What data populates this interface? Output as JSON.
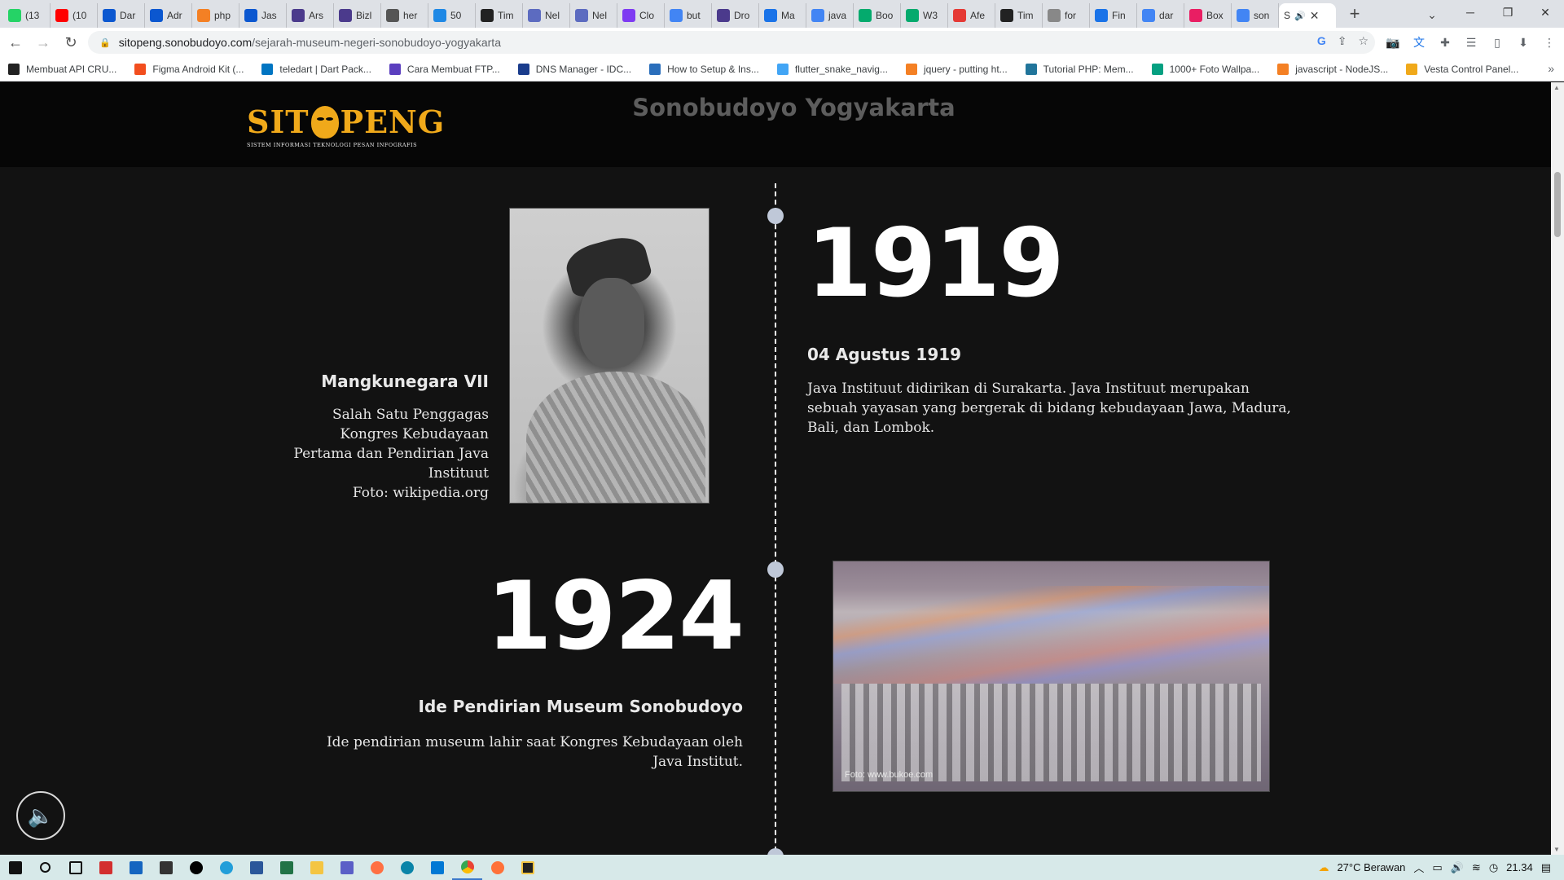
{
  "browser": {
    "tabs": [
      {
        "label": "(13",
        "color": "#25d366"
      },
      {
        "label": "(10",
        "color": "#ff0000"
      },
      {
        "label": "Dar",
        "color": "#0b57d0"
      },
      {
        "label": "Adr",
        "color": "#0b57d0"
      },
      {
        "label": "php",
        "color": "#f48024"
      },
      {
        "label": "Jas",
        "color": "#0b57d0"
      },
      {
        "label": "Ars",
        "color": "#4b3a8c"
      },
      {
        "label": "Bizl",
        "color": "#4b3a8c"
      },
      {
        "label": "her",
        "color": "#555555"
      },
      {
        "label": "50",
        "color": "#1e88e5"
      },
      {
        "label": "Tim",
        "color": "#222222"
      },
      {
        "label": "Nel",
        "color": "#5c6bc0"
      },
      {
        "label": "Nel",
        "color": "#5c6bc0"
      },
      {
        "label": "Clo",
        "color": "#7e3af2"
      },
      {
        "label": "but",
        "color": "#4285f4"
      },
      {
        "label": "Dro",
        "color": "#4b3a8c"
      },
      {
        "label": "Ma",
        "color": "#1a73e8"
      },
      {
        "label": "java",
        "color": "#4285f4"
      },
      {
        "label": "Boo",
        "color": "#04aa6d"
      },
      {
        "label": "W3",
        "color": "#04aa6d"
      },
      {
        "label": "Afe",
        "color": "#e53935"
      },
      {
        "label": "Tim",
        "color": "#222222"
      },
      {
        "label": "for",
        "color": "#888888"
      },
      {
        "label": "Fin",
        "color": "#1a73e8"
      },
      {
        "label": "dar",
        "color": "#4285f4"
      },
      {
        "label": "Box",
        "color": "#e91e63"
      },
      {
        "label": "son",
        "color": "#4285f4"
      }
    ],
    "active_tab": {
      "label": "S",
      "audio_icon": "speaker-icon"
    },
    "url_host": "sitopeng.sonobudoyo.com",
    "url_path": "/sejarah-museum-negeri-sonobudoyo-yogyakarta",
    "bookmarks": [
      {
        "label": "Membuat API CRU...",
        "color": "#222222"
      },
      {
        "label": "Figma Android Kit (...",
        "color": "#f24e1e"
      },
      {
        "label": "teledart | Dart Pack...",
        "color": "#0175c2"
      },
      {
        "label": "Cara Membuat FTP...",
        "color": "#5b3fbf"
      },
      {
        "label": "DNS Manager - IDC...",
        "color": "#1a3c8c"
      },
      {
        "label": "How to Setup & Ins...",
        "color": "#2a6ebb"
      },
      {
        "label": "flutter_snake_navig...",
        "color": "#42a5f5"
      },
      {
        "label": "jquery - putting ht...",
        "color": "#f48024"
      },
      {
        "label": "Tutorial PHP: Mem...",
        "color": "#21759b"
      },
      {
        "label": "1000+ Foto Wallpa...",
        "color": "#05a081"
      },
      {
        "label": "javascript - NodeJS...",
        "color": "#f48024"
      },
      {
        "label": "Vesta Control Panel...",
        "color": "#f0a91a"
      }
    ]
  },
  "site": {
    "logo_text_left": "SIT",
    "logo_text_right": "PENG",
    "logo_sub": "SISTEM INFORMASI TEKNOLOGI PESAN INFOGRAFIS",
    "header_title_line2": "Sonobudoyo Yogyakarta",
    "accent": "#f0a91a"
  },
  "timeline": {
    "entry1": {
      "year": "1919",
      "date": "04 Agustus 1919",
      "text": "Java Instituut didirikan di Surakarta. Java Instituut merupakan sebuah yayasan yang bergerak di bidang kebudayaan Jawa, Madura, Bali, dan Lombok.",
      "person_name": "Mangkunegara VII",
      "caption": "Salah Satu Penggagas Kongres Kebudayaan Pertama dan Pendirian Java Instituut",
      "photo_credit": "Foto: wikipedia.org"
    },
    "entry2": {
      "year": "1924",
      "title": "Ide Pendirian Museum Sonobudoyo",
      "text": "Ide pendirian museum lahir saat Kongres Kebudayaan oleh Java Institut.",
      "photo_credit": "Foto: www.bukoe.com"
    }
  },
  "taskbar": {
    "weather": "27°C  Berawan",
    "time": "21.34"
  }
}
